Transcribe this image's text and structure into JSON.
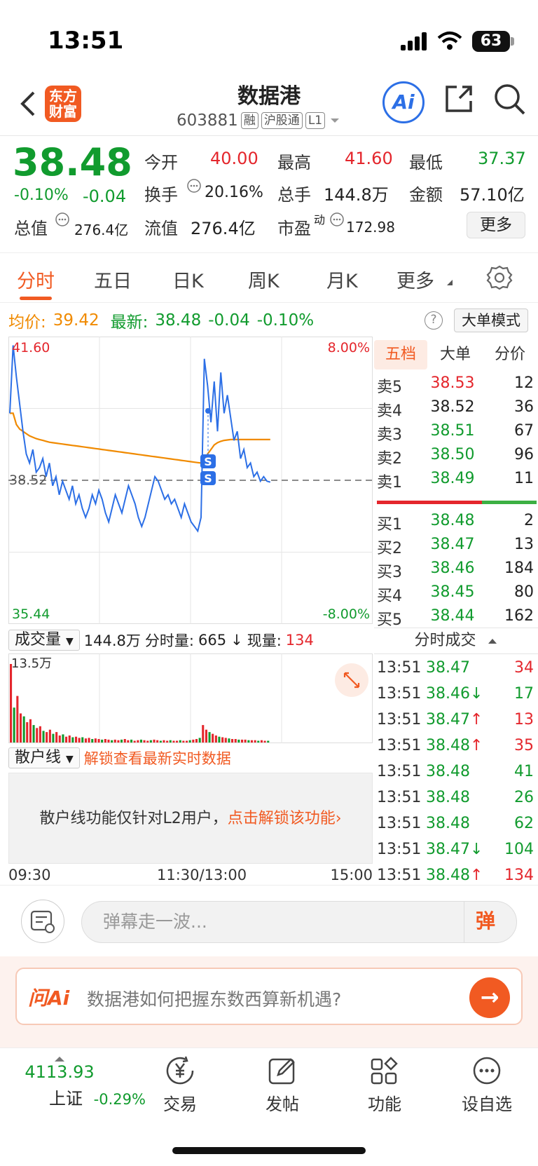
{
  "status": {
    "time": "13:51",
    "battery": "63"
  },
  "header": {
    "logo_text": "东方财富",
    "stock_name": "数据港",
    "stock_code": "603881",
    "tags": [
      "融",
      "沪股通",
      "L1"
    ],
    "ai_label": "Ai"
  },
  "quote": {
    "price": "38.48",
    "change_pct": "-0.10%",
    "change_abs": "-0.04",
    "open_label": "今开",
    "open": "40.00",
    "high_label": "最高",
    "high": "41.60",
    "low_label": "最低",
    "low": "37.37",
    "turnover_label": "换手",
    "turnover": "20.16%",
    "total_hands_label": "总手",
    "total_hands": "144.8万",
    "amount_label": "金额",
    "amount": "57.10亿",
    "total_value_label": "总值",
    "total_value": "276.4亿",
    "float_value_label": "流值",
    "float_value": "276.4亿",
    "pe_label": "市盈",
    "pe_sup": "动",
    "pe": "172.98",
    "more_label": "更多"
  },
  "tabs": [
    "分时",
    "五日",
    "日K",
    "周K",
    "月K",
    "更多"
  ],
  "avg_row": {
    "avg_label": "均价:",
    "avg_value": "39.42",
    "latest_label": "最新:",
    "latest_value": "38.48",
    "latest_chg": "-0.04",
    "latest_pct": "-0.10%",
    "help": "?",
    "mode_btn": "大单模式"
  },
  "chart_data": {
    "type": "line",
    "title": "",
    "y_top_label": "41.60",
    "y_mid_label": "38.52",
    "y_bottom_label": "35.44",
    "pct_top_label": "8.00%",
    "pct_bottom_label": "-8.00%",
    "ylim": [
      35.44,
      41.6
    ],
    "prev_close": 38.52,
    "x_labels": [
      "09:30",
      "11:30/13:00",
      "15:00"
    ],
    "series": [
      {
        "values": [
          40.0,
          41.5,
          40.8,
          40.2,
          39.6,
          39.1,
          38.9,
          39.2,
          38.7,
          38.8,
          39.0,
          38.6,
          38.9,
          38.4,
          38.6,
          38.2,
          38.5,
          38.3,
          38.1,
          38.4,
          38.0,
          38.2,
          37.9,
          37.7,
          37.9,
          38.2,
          38.0,
          38.3,
          38.1,
          37.8,
          37.6,
          37.9,
          38.2,
          38.0,
          37.8,
          38.1,
          38.4,
          38.2,
          38.0,
          37.7,
          37.5,
          37.7,
          38.0,
          38.3,
          38.6,
          38.5,
          38.3,
          38.1,
          38.2,
          38.0,
          38.1,
          37.9,
          37.7,
          38.0,
          37.8,
          37.6,
          37.5,
          37.4,
          37.7,
          41.2,
          40.6,
          39.8,
          40.7,
          39.6,
          40.9,
          40.0,
          40.4,
          39.9,
          39.4,
          39.6,
          39.0,
          39.2,
          38.8,
          38.9,
          38.6,
          38.7,
          38.5,
          38.6,
          38.5,
          38.48
        ]
      },
      {
        "values": [
          40.0,
          40.0,
          39.75,
          39.65,
          39.6,
          39.55,
          39.5,
          39.47,
          39.44,
          39.42,
          39.4,
          39.38,
          39.36,
          39.35,
          39.34,
          39.33,
          39.32,
          39.31,
          39.3,
          39.29,
          39.28,
          39.27,
          39.26,
          39.25,
          39.24,
          39.23,
          39.22,
          39.21,
          39.2,
          39.19,
          39.18,
          39.17,
          39.16,
          39.15,
          39.14,
          39.13,
          39.12,
          39.11,
          39.1,
          39.09,
          39.08,
          39.07,
          39.06,
          39.05,
          39.04,
          39.03,
          39.02,
          39.01,
          39.0,
          38.99,
          38.98,
          38.97,
          38.96,
          38.95,
          38.94,
          38.93,
          38.92,
          38.91,
          38.9,
          38.95,
          39.1,
          39.2,
          39.3,
          39.35,
          39.38,
          39.4,
          39.41,
          39.42,
          39.42,
          39.42,
          39.42,
          39.42,
          39.42,
          39.42,
          39.42,
          39.42,
          39.42,
          39.42,
          39.42,
          39.42
        ]
      }
    ],
    "volume_max_label": "13.5万",
    "volume": [
      135,
      60,
      80,
      50,
      45,
      35,
      40,
      30,
      25,
      28,
      20,
      18,
      22,
      15,
      18,
      12,
      14,
      10,
      12,
      9,
      10,
      8,
      9,
      7,
      8,
      6,
      7,
      6,
      5,
      6,
      5,
      4,
      5,
      4,
      5,
      6,
      4,
      5,
      3,
      4,
      5,
      4,
      3,
      4,
      5,
      4,
      3,
      4,
      3,
      4,
      3,
      3,
      4,
      3,
      3,
      4,
      5,
      6,
      8,
      30,
      22,
      18,
      15,
      12,
      10,
      9,
      8,
      7,
      6,
      6,
      5,
      5,
      5,
      4,
      4,
      4,
      3,
      4,
      3,
      3
    ]
  },
  "orderbook": {
    "tabs": [
      "五档",
      "大单",
      "分价"
    ],
    "asks": [
      {
        "label": "卖5",
        "price": "38.53",
        "vol": "12",
        "color": "red"
      },
      {
        "label": "卖4",
        "price": "38.52",
        "vol": "36",
        "color": "gray"
      },
      {
        "label": "卖3",
        "price": "38.51",
        "vol": "67",
        "color": "green"
      },
      {
        "label": "卖2",
        "price": "38.50",
        "vol": "96",
        "color": "green"
      },
      {
        "label": "卖1",
        "price": "38.49",
        "vol": "11",
        "color": "green"
      }
    ],
    "bids": [
      {
        "label": "买1",
        "price": "38.48",
        "vol": "2"
      },
      {
        "label": "买2",
        "price": "38.47",
        "vol": "13"
      },
      {
        "label": "买3",
        "price": "38.46",
        "vol": "184"
      },
      {
        "label": "买4",
        "price": "38.45",
        "vol": "80"
      },
      {
        "label": "买5",
        "price": "38.44",
        "vol": "162"
      }
    ]
  },
  "trades": {
    "title": "分时成交",
    "rows": [
      {
        "t": "13:51",
        "p": "38.47",
        "arrow": "",
        "v": "34",
        "vc": "red"
      },
      {
        "t": "13:51",
        "p": "38.46",
        "arrow": "↓",
        "v": "17",
        "vc": "green"
      },
      {
        "t": "13:51",
        "p": "38.47",
        "arrow": "↑",
        "v": "13",
        "vc": "red"
      },
      {
        "t": "13:51",
        "p": "38.48",
        "arrow": "↑",
        "v": "35",
        "vc": "red"
      },
      {
        "t": "13:51",
        "p": "38.48",
        "arrow": "",
        "v": "41",
        "vc": "green"
      },
      {
        "t": "13:51",
        "p": "38.48",
        "arrow": "",
        "v": "26",
        "vc": "green"
      },
      {
        "t": "13:51",
        "p": "38.48",
        "arrow": "",
        "v": "62",
        "vc": "green"
      },
      {
        "t": "13:51",
        "p": "38.47",
        "arrow": "↓",
        "v": "104",
        "vc": "green"
      },
      {
        "t": "13:51",
        "p": "38.48",
        "arrow": "↑",
        "v": "134",
        "vc": "red"
      }
    ]
  },
  "volume_bar": {
    "select": "成交量",
    "total": "144.8万",
    "split_label": "分时量:",
    "split_value": "665",
    "arrow": "↓",
    "now_label": "现量:",
    "now_value": "134"
  },
  "retail": {
    "select": "散户线",
    "unlock_text": "解锁查看最新实时数据",
    "box_text": "散户线功能仅针对L2用户，",
    "box_link": "点击解锁该功能"
  },
  "comment": {
    "placeholder": "弹幕走一波...",
    "danmu": "弹"
  },
  "ai_ask": {
    "logo": "问Ai",
    "question": "数据港如何把握东数西算新机遇?"
  },
  "bottom_nav": {
    "index_value": "4113.93",
    "index_name": "上证",
    "index_chg": "-0.29%",
    "items": [
      "交易",
      "发帖",
      "功能",
      "设自选"
    ]
  },
  "colors": {
    "accent": "#f15a22",
    "up": "#e4262c",
    "down": "#119b2e",
    "avg": "#f08a00",
    "line": "#2c6fe6"
  }
}
